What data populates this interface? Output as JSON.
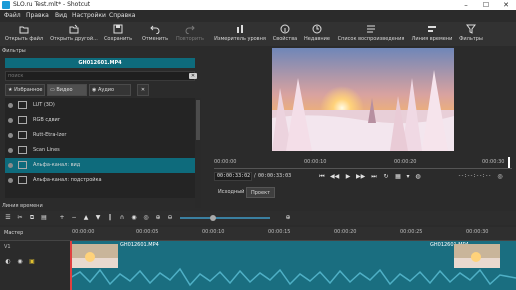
{
  "window": {
    "title": "SLO.ru Test.mlt* - Shotcut",
    "minimize": "–",
    "maximize": "☐",
    "close": "✕"
  },
  "menu": [
    "Файл",
    "Правка",
    "Вид",
    "Настройки",
    "Справка"
  ],
  "toolbar": {
    "open_file": "Открыть файл",
    "open_other": "Открыть другой...",
    "save": "Сохранить",
    "undo": "Отменить",
    "redo": "Повторить",
    "peak_meter": "Измеритель уровня",
    "properties": "Свойства",
    "recent": "Недавние",
    "playlist": "Список воспроизведения",
    "timeline": "Линия времени",
    "filters": "Фильтры"
  },
  "filters_panel": {
    "title": "Фильтры",
    "clip_name": "GH012601.MP4",
    "search_placeholder": "поиск",
    "tabs": [
      "Избранное",
      "Видео",
      "Аудио"
    ],
    "items": [
      "LUT (3D)",
      "RGB сдвиг",
      "Rutt-Etra-Izer",
      "Scan Lines",
      "Альфа-канал: вид",
      "Альфа-канал: подстройка"
    ],
    "selected_index": 4
  },
  "player": {
    "ruler_ticks": [
      "00:00:00",
      "00:00:10",
      "00:00:20",
      "00:00:30"
    ],
    "position": "00:00:33:02",
    "duration": "00:00:33:03",
    "in_out": "--:--:--:--",
    "tabs": [
      "Исходный",
      "Проект"
    ],
    "active_tab": 1
  },
  "timeline": {
    "title": "Линия времени",
    "master_label": "Мастер",
    "track_name": "V1",
    "ruler_ticks": [
      "00:00:00",
      "00:00:05",
      "00:00:10",
      "00:00:15",
      "00:00:20",
      "00:00:25",
      "00:00:30"
    ],
    "clip_label": "GH012601.MP4"
  },
  "colors": {
    "accent": "#0e6b7c",
    "track": "#1a6e80",
    "playhead": "#e04040"
  }
}
